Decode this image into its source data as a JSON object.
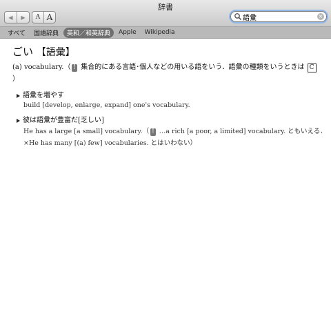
{
  "window": {
    "title": "辞書"
  },
  "toolbar": {
    "back_icon": "◀",
    "forward_icon": "▶",
    "font_small": "A",
    "font_large": "A"
  },
  "search": {
    "value": "語彙",
    "clear": "×"
  },
  "scopes": [
    "すべて",
    "国語辞典",
    "英和／和英辞典",
    "Apple",
    "Wikipedia"
  ],
  "entry": {
    "reading": "ごい",
    "kanji": "【語彙】",
    "def_lead": "(a) vocabulary.（",
    "def_badge": "!",
    "def_text": " 集合的にある言語･個人などの用いる語をいう．語彙の種類をいうときは ",
    "def_box": "C",
    "def_end": "）",
    "sub1": "語彙を増やす",
    "sub1_ex": "build [develop, enlarge, expand] one's vocabulary.",
    "sub2": "彼は語彙が豊富だ[乏しい]",
    "sub2_ex1_a": "He has a large [a small] vocabulary.（",
    "sub2_ex1_badge": "!",
    "sub2_ex1_b": " …a rich [a poor, a limited] vocabulary. ともいえる．",
    "sub2_ex2": "×He has many [(a) few] vocabularies. とはいわない）"
  }
}
